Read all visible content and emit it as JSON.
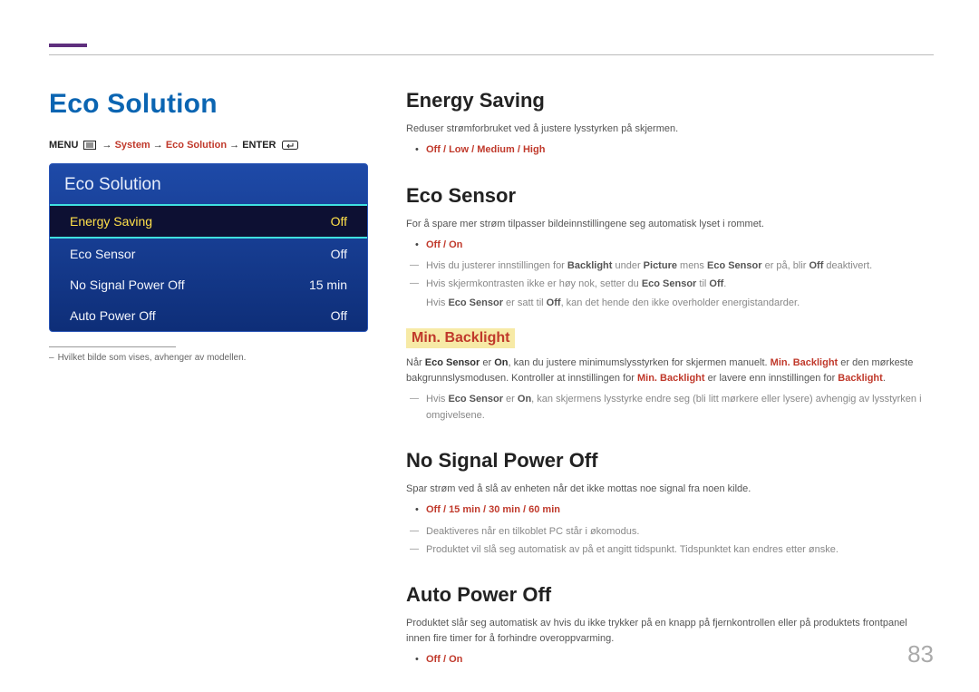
{
  "page_number": "83",
  "left": {
    "title": "Eco Solution",
    "breadcrumb": {
      "menu": "MENU",
      "system": "System",
      "eco": "Eco Solution",
      "enter": "ENTER",
      "arrow": "→"
    },
    "osd": {
      "title": "Eco Solution",
      "rows": [
        {
          "label": "Energy Saving",
          "value": "Off",
          "selected": true
        },
        {
          "label": "Eco Sensor",
          "value": "Off",
          "selected": false
        },
        {
          "label": "No Signal Power Off",
          "value": "15 min",
          "selected": false
        },
        {
          "label": "Auto Power Off",
          "value": "Off",
          "selected": false
        }
      ]
    },
    "footnote": "Hvilket bilde som vises, avhenger av modellen."
  },
  "sections": {
    "energy": {
      "heading": "Energy Saving",
      "desc": "Reduser strømforbruket ved å justere lysstyrken på skjermen.",
      "options": [
        "Off",
        "Low",
        "Medium",
        "High"
      ]
    },
    "ecoSensor": {
      "heading": "Eco Sensor",
      "desc": "For å spare mer strøm tilpasser bildeinnstillingene seg automatisk lyset i rommet.",
      "options": [
        "Off",
        "On"
      ],
      "note1": {
        "p1": "Hvis du justerer innstillingen for ",
        "b1": "Backlight",
        "p2": " under ",
        "b2": "Picture",
        "p3": " mens ",
        "b3": "Eco Sensor",
        "p4": " er på, blir ",
        "b4": "Off",
        "p5": " deaktivert."
      },
      "note2": {
        "p1": "Hvis skjermkontrasten ikke er høy nok, setter du ",
        "b1": "Eco Sensor",
        "p2": " til ",
        "b2": "Off",
        "p3": "."
      },
      "note2b": {
        "p1": "Hvis ",
        "b1": "Eco Sensor",
        "p2": " er satt til ",
        "b2": "Off",
        "p3": ", kan det hende den ikke overholder energistandarder."
      },
      "minBacklight": {
        "heading": "Min. Backlight",
        "desc": {
          "p1": "Når ",
          "b1": "Eco Sensor",
          "p2": " er ",
          "b2": "On",
          "p3": ", kan du justere minimumslysstyrken for skjermen manuelt. ",
          "a1": "Min. Backlight",
          "p4": " er den mørkeste bakgrunnslysmodusen. Kontroller at innstillingen for ",
          "a2": "Min. Backlight",
          "p5": " er lavere enn innstillingen for ",
          "a3": "Backlight",
          "p6": "."
        },
        "note": {
          "p1": "Hvis ",
          "b1": "Eco Sensor",
          "p2": " er ",
          "b2": "On",
          "p3": ", kan skjermens lysstyrke endre seg (bli litt mørkere eller lysere) avhengig av lysstyrken i omgivelsene."
        }
      }
    },
    "noSignal": {
      "heading": "No Signal Power Off",
      "desc": "Spar strøm ved å slå av enheten når det ikke mottas noe signal fra noen kilde.",
      "options": [
        "Off",
        "15 min",
        "30 min",
        "60 min"
      ],
      "note1": "Deaktiveres når en tilkoblet PC står i økomodus.",
      "note2": "Produktet vil slå seg automatisk av på et angitt tidspunkt. Tidspunktet kan endres etter ønske."
    },
    "autoOff": {
      "heading": "Auto Power Off",
      "desc": "Produktet slår seg automatisk av hvis du ikke trykker på en knapp på fjernkontrollen eller på produktets frontpanel innen fire timer for å forhindre overoppvarming.",
      "options": [
        "Off",
        "On"
      ]
    }
  }
}
